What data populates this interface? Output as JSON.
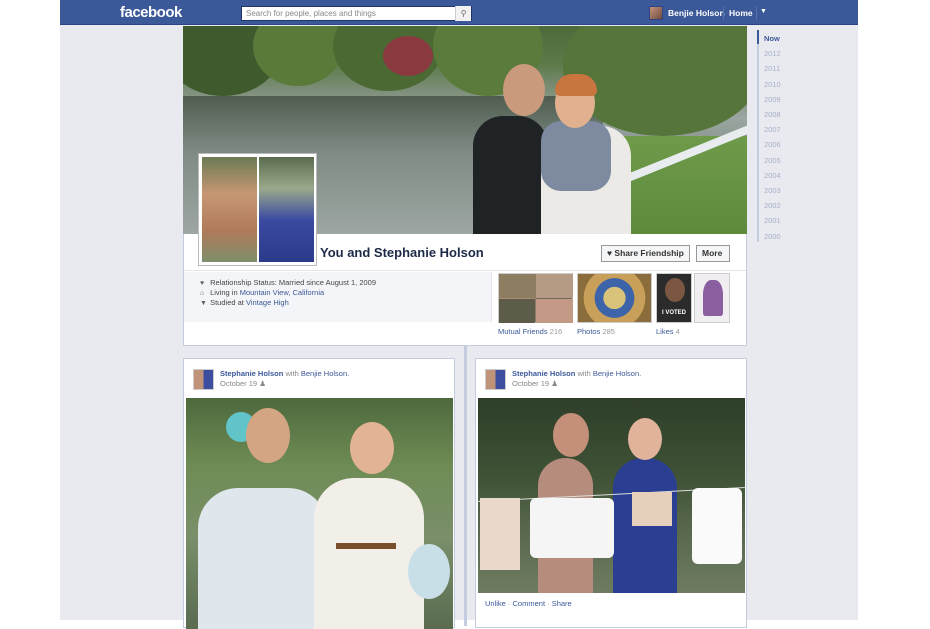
{
  "app": {
    "logo": "facebook",
    "search_placeholder": "Search for people, places and things",
    "user_name": "Benjie Holson",
    "home_label": "Home"
  },
  "profile": {
    "title": "You and Stephanie Holson",
    "share_button": "Share Friendship",
    "more_button": "More",
    "info": {
      "relationship": "Relationship Status: Married since August 1, 2009",
      "living_prefix": "Living in ",
      "living_city": "Mountain View, California",
      "studied_prefix": "Studied at ",
      "studied_school": "Vintage High"
    },
    "tiles": [
      {
        "label": "Mutual Friends",
        "count": "216"
      },
      {
        "label": "Photos",
        "count": "285"
      },
      {
        "label": "Likes",
        "count": "4"
      }
    ],
    "likes_badge": "I VOTED"
  },
  "posts": [
    {
      "author": "Stephanie Holson",
      "with_word": "with",
      "with_name": "Benjie Holson.",
      "date": "October 19"
    },
    {
      "author": "Stephanie Holson",
      "with_word": "with",
      "with_name": "Benjie Holson.",
      "date": "October 19",
      "actions": {
        "unlike": "Unlike",
        "comment": "Comment",
        "share": "Share",
        "sep": " · "
      }
    }
  ],
  "timeline_years": [
    "Now",
    "2012",
    "2011",
    "2010",
    "2009",
    "2008",
    "2007",
    "2006",
    "2005",
    "2004",
    "2003",
    "2002",
    "2001",
    "2000"
  ],
  "colors": {
    "brand": "#3b5998",
    "background": "#e9eaf0",
    "link": "#3b5998"
  }
}
